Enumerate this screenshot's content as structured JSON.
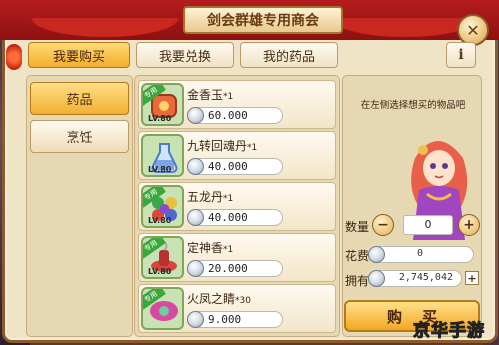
{
  "window": {
    "title": "剑会群雄专用商会",
    "close_icon": "close-icon",
    "info_label": "i"
  },
  "tabs": [
    {
      "label": "我要购买",
      "active": true
    },
    {
      "label": "我要兑换",
      "active": false
    },
    {
      "label": "我的药品",
      "active": false
    }
  ],
  "categories": [
    {
      "label": "药品",
      "active": true
    },
    {
      "label": "烹饪",
      "active": false
    }
  ],
  "items": [
    {
      "name": "金香玉",
      "qty": "*1",
      "price": "60.000",
      "tag": "专用",
      "level": "LV.80",
      "color": "#e86a3a"
    },
    {
      "name": "九转回魂丹",
      "qty": "*1",
      "price": "40.000",
      "tag": "",
      "level": "LV.80",
      "color": "#4a7ad0"
    },
    {
      "name": "五龙丹",
      "qty": "*1",
      "price": "40.000",
      "tag": "专用",
      "level": "LV.80",
      "color": "#3aa84a"
    },
    {
      "name": "定神香",
      "qty": "*1",
      "price": "20.000",
      "tag": "专用",
      "level": "LV.80",
      "color": "#d8463a"
    },
    {
      "name": "火凤之睛",
      "qty": "*30",
      "price": "9.000",
      "tag": "专用",
      "level": "",
      "color": "#d84aa0"
    }
  ],
  "detail": {
    "hint": "在左侧选择想买的物品吧",
    "quantity_label": "数量",
    "quantity_value": "0",
    "cost_label": "花费",
    "cost_value": "0",
    "owned_label": "拥有",
    "owned_value": "2,745,042",
    "buy_label_1": "购",
    "buy_label_2": "买"
  },
  "watermark": "京华手游"
}
